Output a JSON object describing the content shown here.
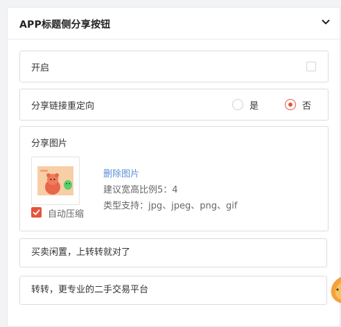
{
  "panel": {
    "title": "APP标题侧分享按钮",
    "collapse_icon": "chevron-down-icon"
  },
  "enable": {
    "label": "开启",
    "checked": false
  },
  "redirect": {
    "label": "分享链接重定向",
    "options": [
      {
        "label": "是",
        "selected": false
      },
      {
        "label": "否",
        "selected": true
      }
    ]
  },
  "share_image": {
    "label": "分享图片",
    "thumbnail_icon": "share-image-thumbnail",
    "delete_label": "删除图片",
    "ratio_hint": "建议宽高比例5：4",
    "type_hint": "类型支持：jpg、jpeg、png、gif",
    "auto_compress_label": "自动压缩",
    "auto_compress_checked": true
  },
  "share_title": {
    "value": "买卖闲置，上转转就对了"
  },
  "share_desc": {
    "value": "转转，更专业的二手交易平台"
  },
  "colors": {
    "accent": "#e5533d",
    "link": "#5b8fd9",
    "border": "#dcdcdc"
  }
}
